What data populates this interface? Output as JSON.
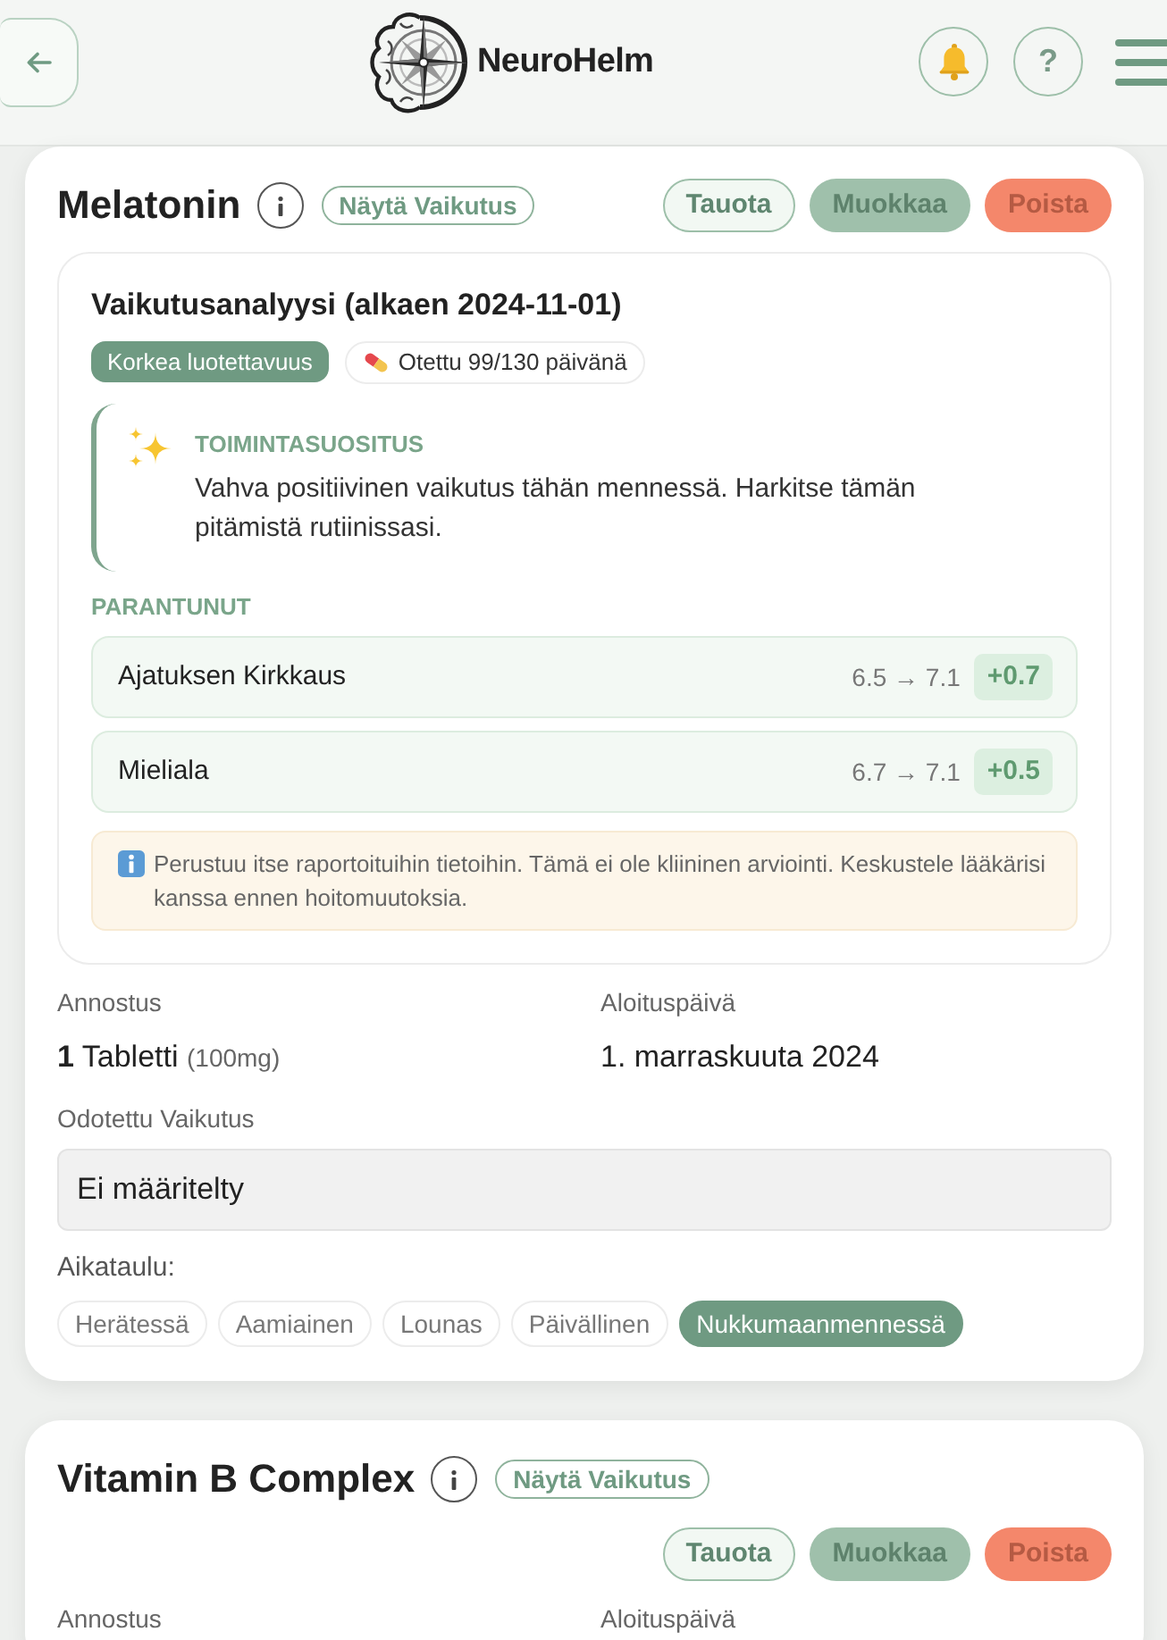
{
  "header": {
    "brand": "NeuroHelm",
    "help_button": "?"
  },
  "supplements": [
    {
      "name": "Melatonin",
      "impact_link": "Näytä Vaikutus",
      "actions": [
        {
          "kind": "pause",
          "label": "Tauota"
        },
        {
          "kind": "edit",
          "label": "Muokkaa"
        },
        {
          "kind": "delete",
          "label": "Poista"
        }
      ],
      "analysis": {
        "title": "Vaikutusanalyysi (alkaen 2024-11-01)",
        "badges": [
          {
            "kind": "confidence",
            "label": "Korkea luotettavuus"
          },
          {
            "kind": "adherence",
            "label": "Otettu 99/130 päivänä"
          }
        ],
        "recommendation": {
          "heading": "TOIMINTASUOSITUS",
          "text": "Vahva positiivinen vaikutus tähän mennessä. Harkitse tämän pitämistä rutiinissasi."
        },
        "improved": {
          "heading": "PARANTUNUT",
          "metrics": [
            {
              "name": "Ajatuksen Kirkkaus",
              "values": "6.5 → 7.1",
              "change": "+0.7"
            },
            {
              "name": "Mieliala",
              "values": "6.7 → 7.1",
              "change": "+0.5"
            }
          ]
        },
        "disclaimer": "Perustuu itse raportoituihin tietoihin. Tämä ei ole kliininen arviointi. Keskustele lääkärisi kanssa ennen hoitomuutoksia."
      },
      "dose": {
        "label": "Annostus",
        "amount": "1",
        "unit": "Tabletti",
        "strength": "(100mg)"
      },
      "start_date": {
        "label": "Aloituspäivä",
        "value": "1. marraskuuta 2024"
      },
      "expected_effect": {
        "label": "Odotettu Vaikutus",
        "value": "Ei määritelty"
      },
      "schedule": {
        "label": "Aikataulu:",
        "options": [
          {
            "label": "Herätessä",
            "selected": false
          },
          {
            "label": "Aamiainen",
            "selected": false
          },
          {
            "label": "Lounas",
            "selected": false
          },
          {
            "label": "Päivällinen",
            "selected": false
          },
          {
            "label": "Nukkumaanmennessä",
            "selected": true
          }
        ]
      }
    },
    {
      "name": "Vitamin B Complex",
      "impact_link": "Näytä Vaikutus",
      "actions": [
        {
          "kind": "pause",
          "label": "Tauota"
        },
        {
          "kind": "edit",
          "label": "Muokkaa"
        },
        {
          "kind": "delete",
          "label": "Poista"
        }
      ],
      "dose": {
        "label": "Annostus"
      },
      "start_date": {
        "label": "Aloituspäivä"
      }
    }
  ]
}
